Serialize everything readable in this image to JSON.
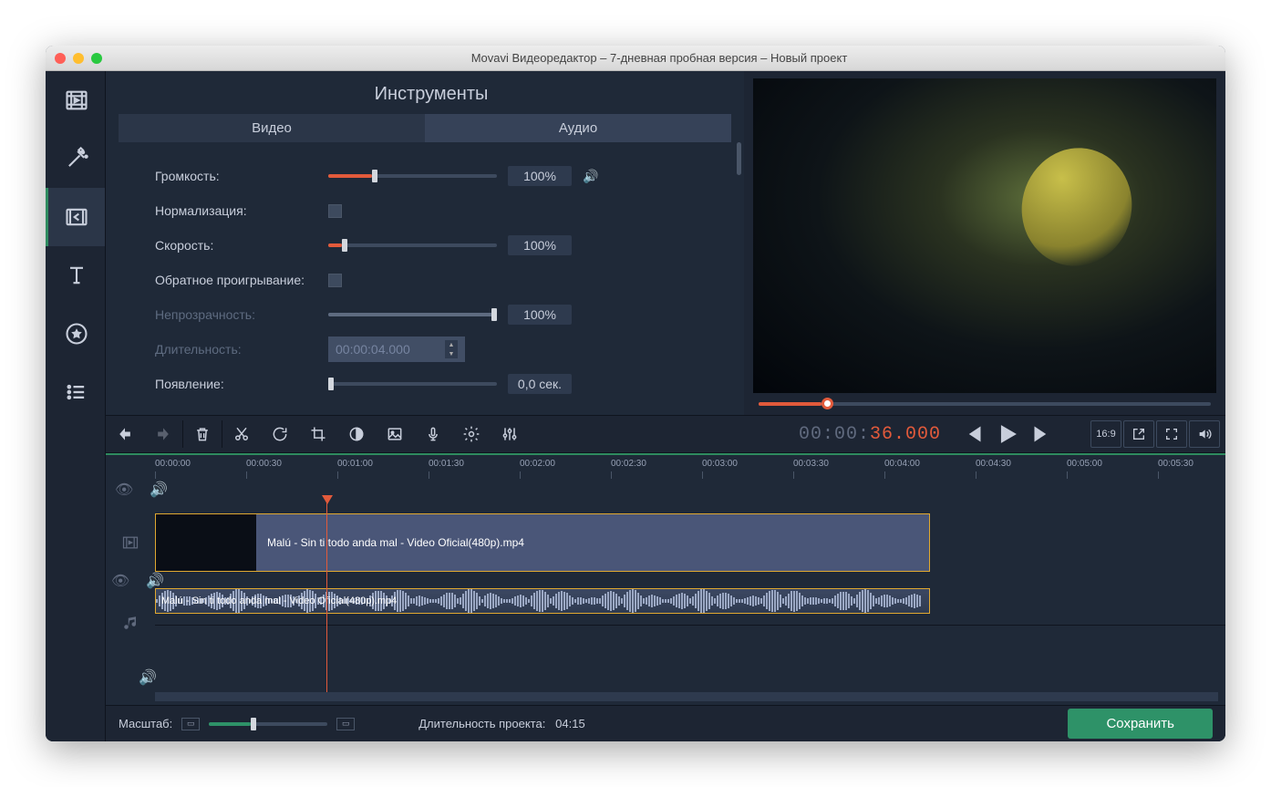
{
  "window": {
    "title": "Movavi Видеоредактор – 7-дневная пробная версия – Новый проект"
  },
  "tools": {
    "title": "Инструменты",
    "tab_video": "Видео",
    "tab_audio": "Аудио",
    "volume_label": "Громкость:",
    "volume_value": "100%",
    "normalize_label": "Нормализация:",
    "speed_label": "Скорость:",
    "speed_value": "100%",
    "reverse_label": "Обратное проигрывание:",
    "opacity_label": "Непрозрачность:",
    "opacity_value": "100%",
    "duration_label": "Длительность:",
    "duration_value": "00:00:04.000",
    "fadein_label": "Появление:",
    "fadein_value": "0,0 сек."
  },
  "playback": {
    "timecode_hms": "00:00:",
    "timecode_sec": "36.000",
    "aspect": "16:9"
  },
  "ruler": [
    "00:00:00",
    "00:00:30",
    "00:01:00",
    "00:01:30",
    "00:02:00",
    "00:02:30",
    "00:03:00",
    "00:03:30",
    "00:04:00",
    "00:04:30",
    "00:05:00",
    "00:05:30"
  ],
  "clip": {
    "name": "Malú - Sin ti todo anda mal - Video Oficial(480p).mp4"
  },
  "footer": {
    "zoom_label": "Масштаб:",
    "duration_label": "Длительность проекта:",
    "duration_value": "04:15",
    "save_label": "Сохранить"
  }
}
